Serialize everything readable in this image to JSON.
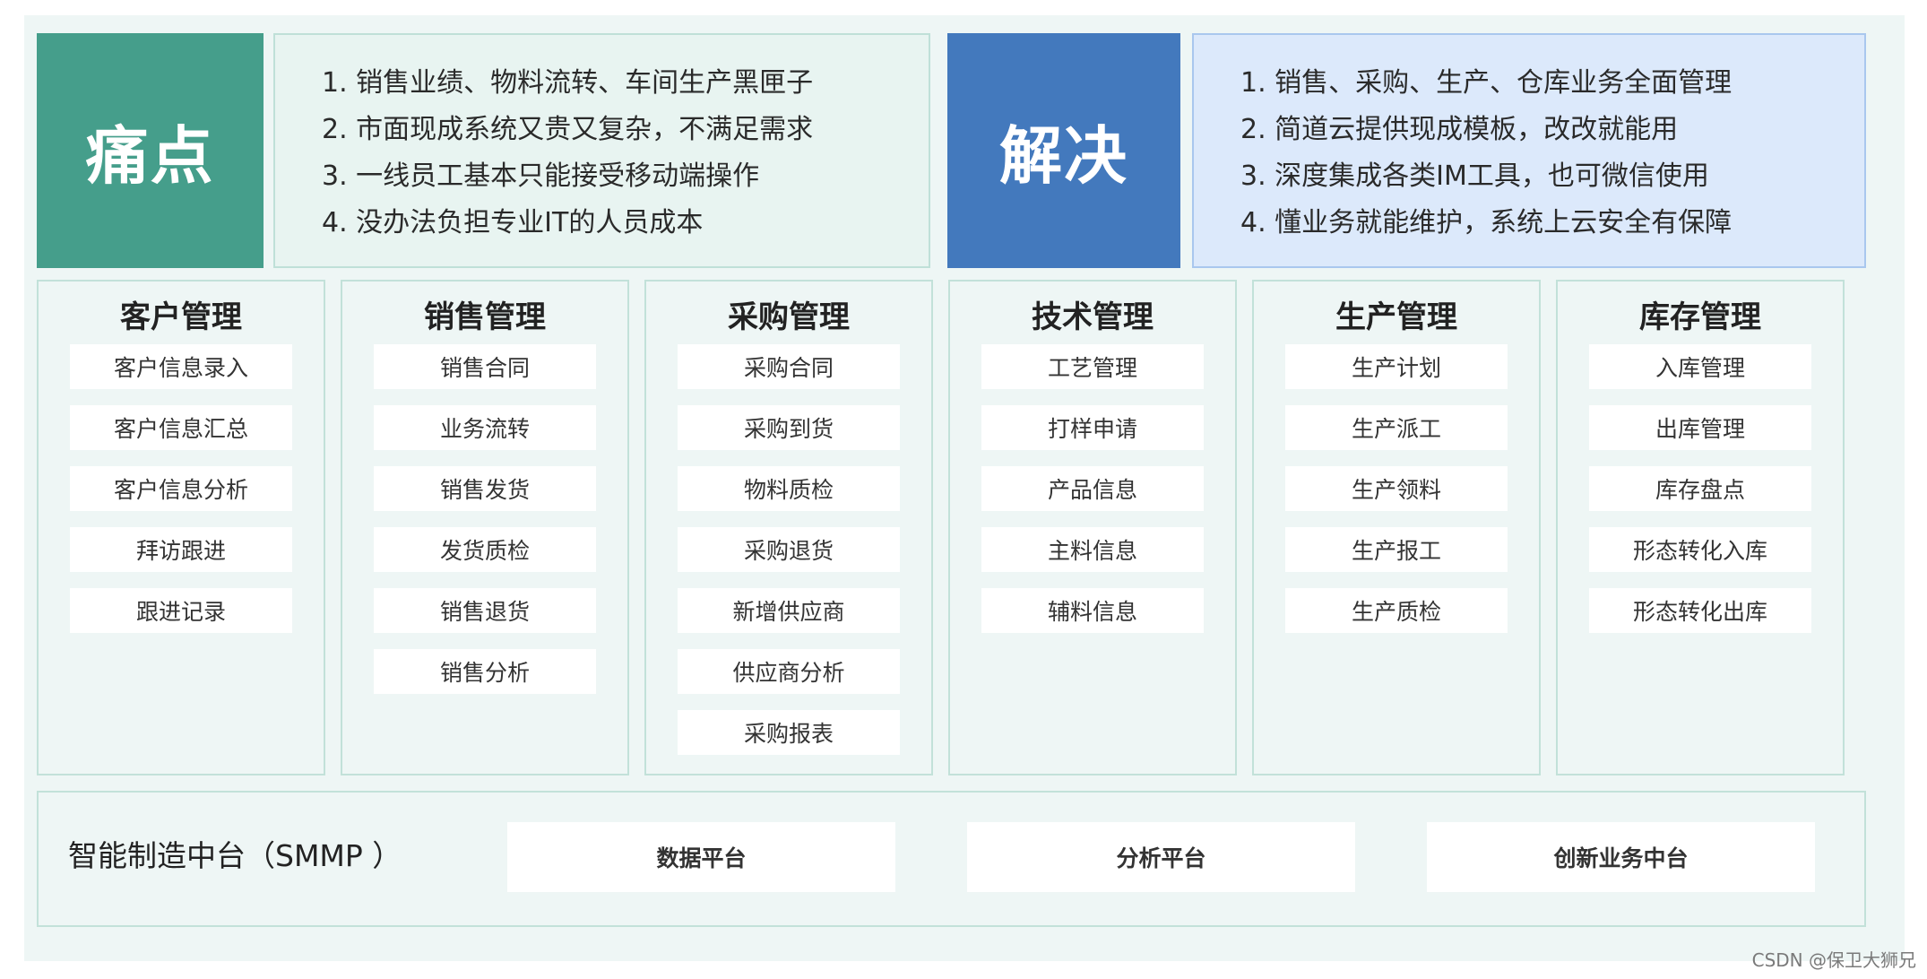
{
  "pain": {
    "label": "痛点",
    "points": [
      "1. 销售业绩、物料流转、车间生产黑匣子",
      "2. 市面现成系统又贵又复杂，不满足需求",
      "3. 一线员工基本只能接受移动端操作",
      "4. 没办法负担专业IT的人员成本"
    ]
  },
  "solution": {
    "label": "解决",
    "points": [
      "1. 销售、采购、生产、仓库业务全面管理",
      "2. 简道云提供现成模板，改改就能用",
      "3. 深度集成各类IM工具，也可微信使用",
      "4. 懂业务就能维护，系统上云安全有保障"
    ]
  },
  "modules": [
    {
      "title": "客户管理",
      "items": [
        "客户信息录入",
        "客户信息汇总",
        "客户信息分析",
        "拜访跟进",
        "跟进记录"
      ]
    },
    {
      "title": "销售管理",
      "items": [
        "销售合同",
        "业务流转",
        "销售发货",
        "发货质检",
        "销售退货",
        "销售分析"
      ]
    },
    {
      "title": "采购管理",
      "items": [
        "采购合同",
        "采购到货",
        "物料质检",
        "采购退货",
        "新增供应商",
        "供应商分析",
        "采购报表"
      ]
    },
    {
      "title": "技术管理",
      "items": [
        "工艺管理",
        "打样申请",
        "产品信息",
        "主料信息",
        "辅料信息"
      ]
    },
    {
      "title": "生产管理",
      "items": [
        "生产计划",
        "生产派工",
        "生产领料",
        "生产报工",
        "生产质检"
      ]
    },
    {
      "title": "库存管理",
      "items": [
        "入库管理",
        "出库管理",
        "库存盘点",
        "形态转化入库",
        "形态转化出库"
      ]
    }
  ],
  "platform": {
    "label": "智能制造中台（SMMP ）",
    "items": [
      "数据平台",
      "分析平台",
      "创新业务中台"
    ]
  },
  "watermark": "CSDN @保卫大狮兄",
  "colors": {
    "pain_accent": "#459e8b",
    "solution_accent": "#4379bd",
    "background": "#eef6f5"
  }
}
